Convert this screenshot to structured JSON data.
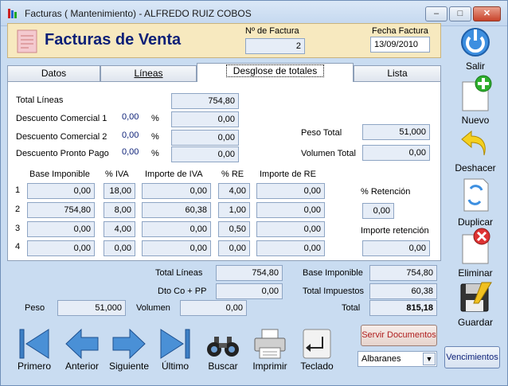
{
  "window": {
    "title": "Facturas ( Mantenimiento) - ALFREDO RUIZ COBOS"
  },
  "header": {
    "title": "Facturas de Venta",
    "num_label": "Nº de Factura",
    "num_value": "2",
    "fecha_label": "Fecha Factura",
    "fecha_value": "13/09/2010"
  },
  "tabs": [
    "Datos",
    "Líneas",
    "Desglose de totales",
    "Lista"
  ],
  "desglose": {
    "total_lineas_label": "Total Líneas",
    "total_lineas": "754,80",
    "dc1_label": "Descuento Comercial 1",
    "dc1_pct": "0,00",
    "dc1": "0,00",
    "dc2_label": "Descuento Comercial 2",
    "dc2_pct": "0,00",
    "dc2": "0,00",
    "dpp_label": "Descuento Pronto Pago",
    "dpp_pct": "0,00",
    "dpp": "0,00",
    "pct_sign": "%",
    "peso_label": "Peso Total",
    "peso": "51,000",
    "volumen_label": "Volumen Total",
    "volumen": "0,00",
    "headers": [
      "Base Imponible",
      "% IVA",
      "Importe de IVA",
      "% RE",
      "Importe de RE"
    ],
    "rows": [
      {
        "n": "1",
        "base": "0,00",
        "iva": "18,00",
        "imp_iva": "0,00",
        "re": "4,00",
        "imp_re": "0,00"
      },
      {
        "n": "2",
        "base": "754,80",
        "iva": "8,00",
        "imp_iva": "60,38",
        "re": "1,00",
        "imp_re": "0,00"
      },
      {
        "n": "3",
        "base": "0,00",
        "iva": "4,00",
        "imp_iva": "0,00",
        "re": "0,50",
        "imp_re": "0,00"
      },
      {
        "n": "4",
        "base": "0,00",
        "iva": "0,00",
        "imp_iva": "0,00",
        "re": "0,00",
        "imp_re": "0,00"
      }
    ],
    "ret_label": "% Retención",
    "ret": "0,00",
    "imp_ret_label": "Importe retención",
    "imp_ret": "0,00"
  },
  "summary": {
    "total_lineas_label": "Total Líneas",
    "total_lineas": "754,80",
    "dto_label": "Dto Co + PP",
    "dto": "0,00",
    "peso_label": "Peso",
    "peso": "51,000",
    "volumen_label": "Volumen",
    "volumen": "0,00",
    "base_label": "Base Imponible",
    "base": "754,80",
    "imp_label": "Total Impuestos",
    "imp": "60,38",
    "total_label": "Total",
    "total": "815,18"
  },
  "toolbar": {
    "primero": "Primero",
    "anterior": "Anterior",
    "siguiente": "Siguiente",
    "ultimo": "Último",
    "buscar": "Buscar",
    "imprimir": "Imprimir",
    "teclado": "Teclado"
  },
  "actions": {
    "servir": "Servir Documentos",
    "select_value": "Albaranes",
    "vencimientos": "Vencimientos"
  },
  "sidebar": {
    "salir": "Salir",
    "nuevo": "Nuevo",
    "deshacer": "Deshacer",
    "duplicar": "Duplicar",
    "eliminar": "Eliminar",
    "guardar": "Guardar"
  },
  "colors": {
    "accent": "#0b1f77",
    "panel_bg": "#c9dcf1",
    "header_bg": "#f7e9bf"
  }
}
